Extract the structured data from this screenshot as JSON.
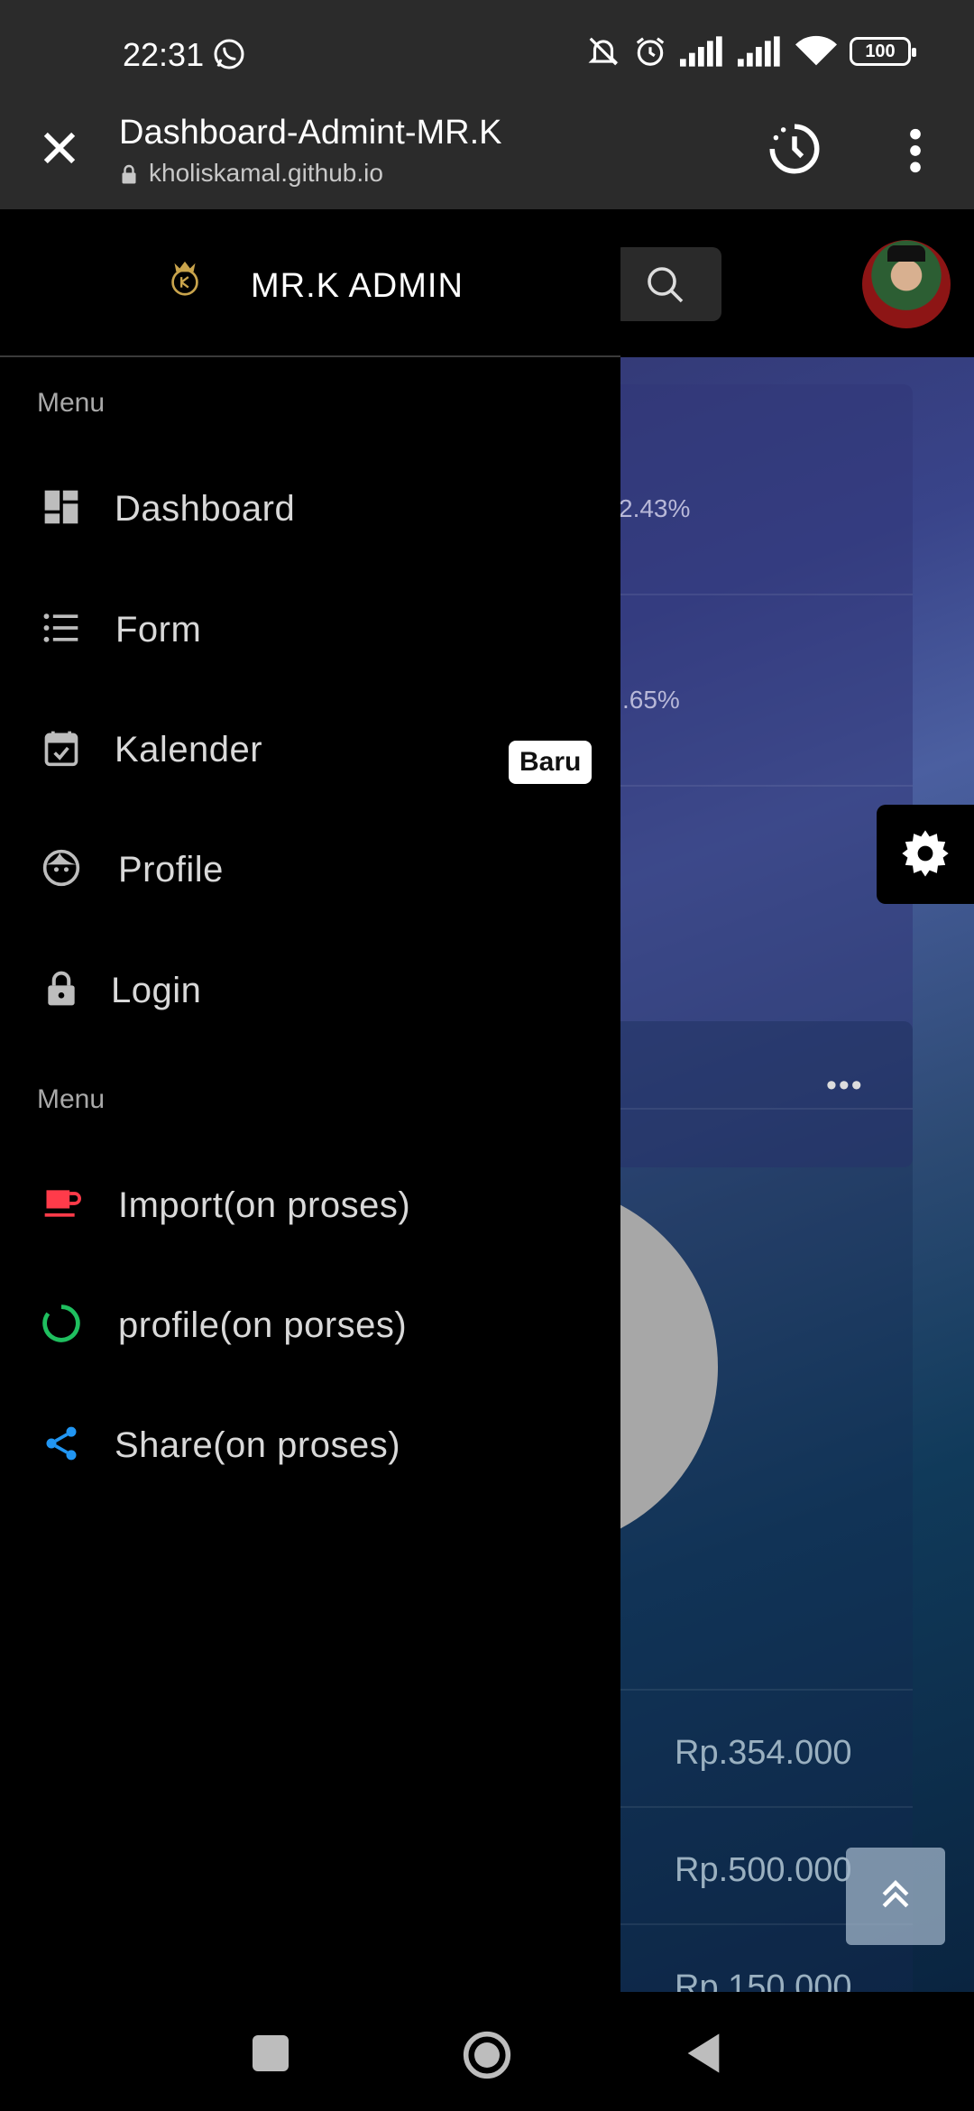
{
  "status": {
    "time": "22:31",
    "battery": "100"
  },
  "browser": {
    "title": "Dashboard-Admint-MR.K",
    "url": "kholiskamal.github.io"
  },
  "drawer": {
    "brand": "MR.K ADMIN",
    "section1_title": "Menu",
    "section2_title": "Menu",
    "items": [
      {
        "label": "Dashboard",
        "icon": "dashboard-icon"
      },
      {
        "label": "Form",
        "icon": "list-icon"
      },
      {
        "label": "Kalender",
        "icon": "calendar-check-icon",
        "badge": "Baru"
      },
      {
        "label": "Profile",
        "icon": "face-icon"
      },
      {
        "label": "Login",
        "icon": "lock-icon"
      }
    ],
    "items2": [
      {
        "label": "Import(on proses)",
        "icon": "coffee-icon",
        "color": "#ff3b4a"
      },
      {
        "label": "profile(on porses)",
        "icon": "loading-ring-icon",
        "color": "#1fbf5f"
      },
      {
        "label": "Share(on proses)",
        "icon": "share-icon",
        "color": "#2196f3"
      }
    ]
  },
  "background": {
    "stat1": "2.43%",
    "stat2": ".65%",
    "amounts": [
      "Rp.354.000",
      "Rp.500.000",
      "Rp.150.000"
    ],
    "more": "•••"
  }
}
